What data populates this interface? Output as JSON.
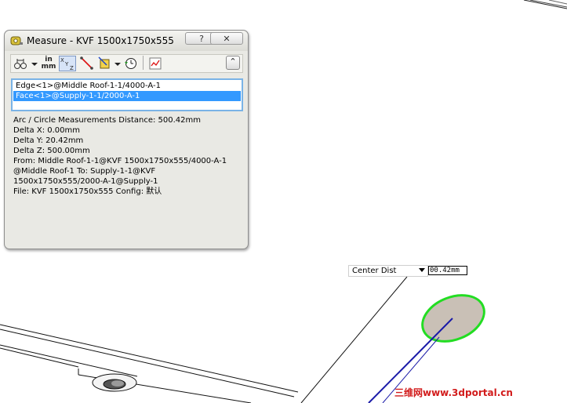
{
  "dialog": {
    "title": "Measure - KVF 1500x1750x555",
    "help_glyph": "?",
    "close_glyph": "✕",
    "units_top": "in",
    "units_bottom": "mm",
    "xyz_label": "XYZ",
    "collapse_glyph": "⌃"
  },
  "selections": [
    "Edge<1>@Middle Roof-1-1/4000-A-1",
    "Face<1>@Supply-1-1/2000-A-1"
  ],
  "results": [
    "Arc / Circle Measurements Distance: 500.42mm",
    "Delta X: 0.00mm",
    "Delta Y: 20.42mm",
    "Delta Z: 500.00mm",
    "From: Middle Roof-1-1@KVF 1500x1750x555/4000-A-1",
    "@Middle Roof-1 To: Supply-1-1@KVF",
    "1500x1750x555/2000-A-1@Supply-1",
    "File: KVF 1500x1750x555 Config: 默认"
  ],
  "dimension": {
    "type_label": "Center Dist",
    "value": "00.42mm"
  },
  "watermark": "三维网www.3dportal.cn",
  "colors": {
    "selection_highlight": "#3399ff",
    "circle_outline": "#22dd22",
    "axis_line": "#1a1aa8",
    "watermark": "#d21c1c"
  },
  "icons": [
    "measure-tape-icon",
    "arc-circle-options-icon",
    "units-icon",
    "xyz-icon",
    "point-to-point-icon",
    "projection-icon",
    "history-icon",
    "sensor-icon",
    "collapse-icon"
  ]
}
